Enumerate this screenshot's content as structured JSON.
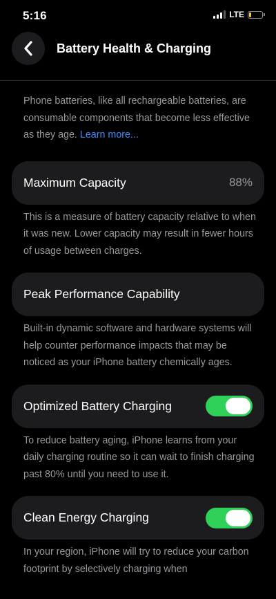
{
  "status": {
    "time": "5:16",
    "network": "LTE",
    "battery_level": 0.2,
    "battery_color": "#f5cc2d"
  },
  "nav": {
    "back_icon": "chevron-left-icon",
    "title": "Battery Health & Charging"
  },
  "intro": {
    "text": "Phone batteries, like all rechargeable batteries, are consumable components that become less effective as they age.",
    "link": "Learn more..."
  },
  "maximum_capacity": {
    "label": "Maximum Capacity",
    "value": "88%",
    "footnote": "This is a measure of battery capacity relative to when it was new. Lower capacity may result in fewer hours of usage between charges."
  },
  "peak_performance": {
    "label": "Peak Performance Capability",
    "footnote": "Built-in dynamic software and hardware systems will help counter performance impacts that may be noticed as your iPhone battery chemically ages."
  },
  "optimized_charging": {
    "label": "Optimized Battery Charging",
    "enabled": true,
    "footnote": "To reduce battery aging, iPhone learns from your daily charging routine so it can wait to finish charging past 80% until you need to use it."
  },
  "clean_energy": {
    "label": "Clean Energy Charging",
    "enabled": true,
    "footnote": "In your region, iPhone will try to reduce your carbon footprint by selectively charging when"
  },
  "colors": {
    "toggle_on": "#30d158",
    "link": "#3a8cff",
    "card_bg": "#1c1c1e"
  }
}
